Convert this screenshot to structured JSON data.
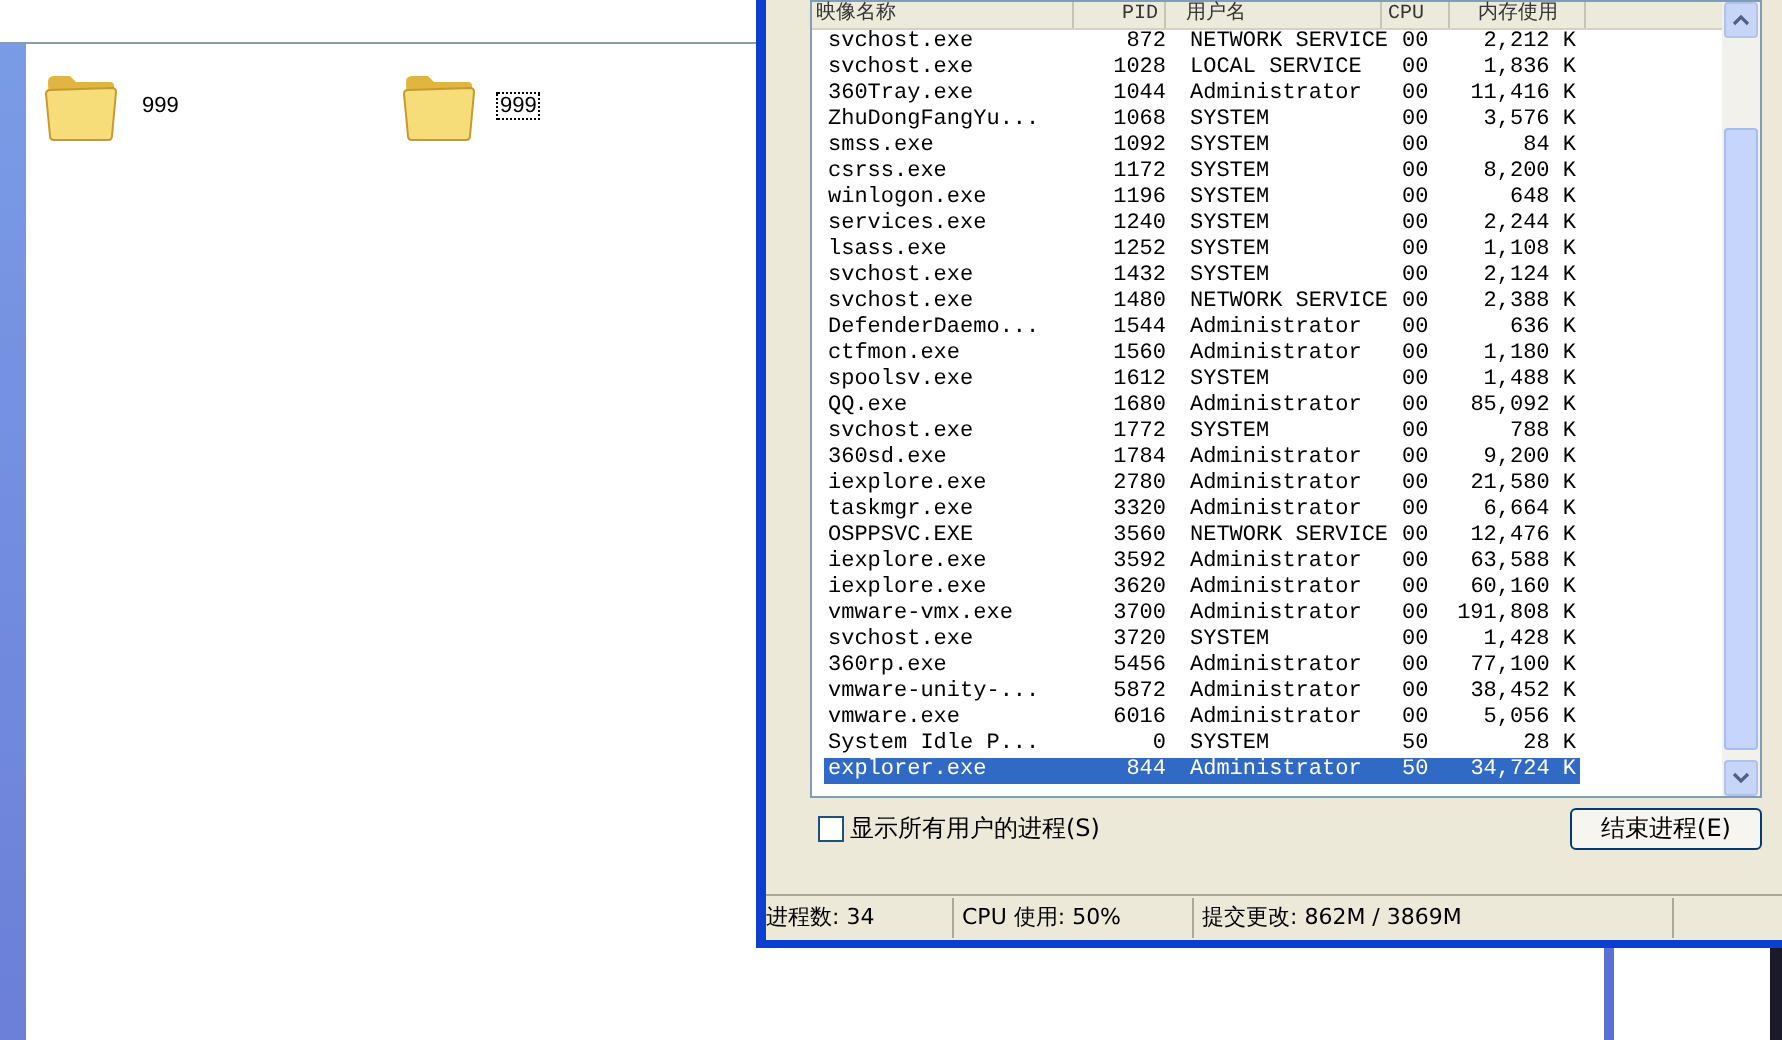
{
  "explorer": {
    "items": [
      {
        "label": "999",
        "selected": false
      },
      {
        "label": "999",
        "selected": true
      }
    ]
  },
  "task_manager": {
    "table": {
      "columns": [
        "映像名称",
        "PID",
        "用户名",
        "CPU",
        "内存使用"
      ],
      "rows": [
        {
          "cells": [
            "svchost.exe",
            "872",
            "NETWORK SERVICE",
            "00",
            "2,212 K"
          ],
          "selected": false
        },
        {
          "cells": [
            "svchost.exe",
            "1028",
            "LOCAL SERVICE",
            "00",
            "1,836 K"
          ],
          "selected": false
        },
        {
          "cells": [
            "360Tray.exe",
            "1044",
            "Administrator",
            "00",
            "11,416 K"
          ],
          "selected": false
        },
        {
          "cells": [
            "ZhuDongFangYu...",
            "1068",
            "SYSTEM",
            "00",
            "3,576 K"
          ],
          "selected": false
        },
        {
          "cells": [
            "smss.exe",
            "1092",
            "SYSTEM",
            "00",
            "84 K"
          ],
          "selected": false
        },
        {
          "cells": [
            "csrss.exe",
            "1172",
            "SYSTEM",
            "00",
            "8,200 K"
          ],
          "selected": false
        },
        {
          "cells": [
            "winlogon.exe",
            "1196",
            "SYSTEM",
            "00",
            "648 K"
          ],
          "selected": false
        },
        {
          "cells": [
            "services.exe",
            "1240",
            "SYSTEM",
            "00",
            "2,244 K"
          ],
          "selected": false
        },
        {
          "cells": [
            "lsass.exe",
            "1252",
            "SYSTEM",
            "00",
            "1,108 K"
          ],
          "selected": false
        },
        {
          "cells": [
            "svchost.exe",
            "1432",
            "SYSTEM",
            "00",
            "2,124 K"
          ],
          "selected": false
        },
        {
          "cells": [
            "svchost.exe",
            "1480",
            "NETWORK SERVICE",
            "00",
            "2,388 K"
          ],
          "selected": false
        },
        {
          "cells": [
            "DefenderDaemo...",
            "1544",
            "Administrator",
            "00",
            "636 K"
          ],
          "selected": false
        },
        {
          "cells": [
            "ctfmon.exe",
            "1560",
            "Administrator",
            "00",
            "1,180 K"
          ],
          "selected": false
        },
        {
          "cells": [
            "spoolsv.exe",
            "1612",
            "SYSTEM",
            "00",
            "1,488 K"
          ],
          "selected": false
        },
        {
          "cells": [
            "QQ.exe",
            "1680",
            "Administrator",
            "00",
            "85,092 K"
          ],
          "selected": false
        },
        {
          "cells": [
            "svchost.exe",
            "1772",
            "SYSTEM",
            "00",
            "788 K"
          ],
          "selected": false
        },
        {
          "cells": [
            "360sd.exe",
            "1784",
            "Administrator",
            "00",
            "9,200 K"
          ],
          "selected": false
        },
        {
          "cells": [
            "iexplore.exe",
            "2780",
            "Administrator",
            "00",
            "21,580 K"
          ],
          "selected": false
        },
        {
          "cells": [
            "taskmgr.exe",
            "3320",
            "Administrator",
            "00",
            "6,664 K"
          ],
          "selected": false
        },
        {
          "cells": [
            "OSPPSVC.EXE",
            "3560",
            "NETWORK SERVICE",
            "00",
            "12,476 K"
          ],
          "selected": false
        },
        {
          "cells": [
            "iexplore.exe",
            "3592",
            "Administrator",
            "00",
            "63,588 K"
          ],
          "selected": false
        },
        {
          "cells": [
            "iexplore.exe",
            "3620",
            "Administrator",
            "00",
            "60,160 K"
          ],
          "selected": false
        },
        {
          "cells": [
            "vmware-vmx.exe",
            "3700",
            "Administrator",
            "00",
            "191,808 K"
          ],
          "selected": false
        },
        {
          "cells": [
            "svchost.exe",
            "3720",
            "SYSTEM",
            "00",
            "1,428 K"
          ],
          "selected": false
        },
        {
          "cells": [
            "360rp.exe",
            "5456",
            "Administrator",
            "00",
            "77,100 K"
          ],
          "selected": false
        },
        {
          "cells": [
            "vmware-unity-...",
            "5872",
            "Administrator",
            "00",
            "38,452 K"
          ],
          "selected": false
        },
        {
          "cells": [
            "vmware.exe",
            "6016",
            "Administrator",
            "00",
            "5,056 K"
          ],
          "selected": false
        },
        {
          "cells": [
            "System Idle P...",
            "0",
            "SYSTEM",
            "50",
            "28 K"
          ],
          "selected": false
        },
        {
          "cells": [
            "explorer.exe",
            "844",
            "Administrator",
            "50",
            "34,724 K"
          ],
          "selected": true
        }
      ]
    },
    "show_all_users": {
      "label": "显示所有用户的进程(S)",
      "checked": false
    },
    "end_button": "结束进程(E)",
    "status_bar": [
      "进程数: 34",
      "CPU 使用: 50%",
      "提交更改: 862M / 3869M"
    ]
  }
}
